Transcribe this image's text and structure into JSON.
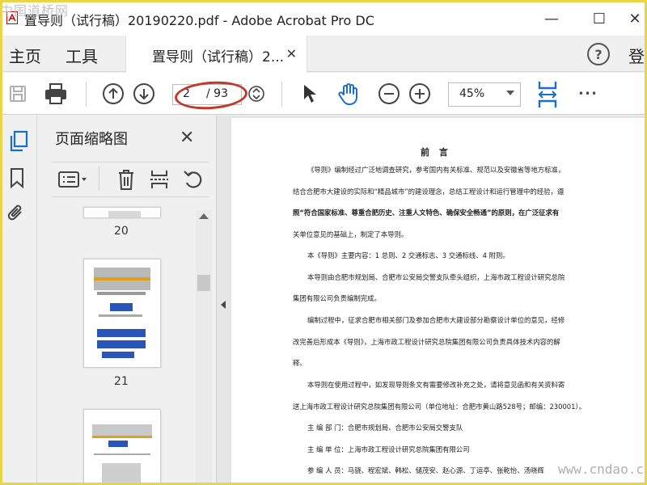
{
  "window": {
    "title": "置导则（试行稿）20190220.pdf - Adobe Acrobat Pro DC",
    "minimize": "—",
    "maximize": "☐",
    "close": "✕"
  },
  "watermark_top": "中国道桥网",
  "watermark_bottom": "www.cndao.com",
  "nav": {
    "home": "主页",
    "tools": "工具",
    "login": "登"
  },
  "doc_tab": {
    "label": "置导则（试行稿）2...",
    "close": "✕"
  },
  "help": "?",
  "toolbar": {
    "current_page": "2",
    "total_pages": "/ 93",
    "zoom": "45%",
    "more": "•••"
  },
  "panel": {
    "title": "页面缩略图",
    "close": "✕",
    "thumbnails": [
      {
        "label": "20"
      },
      {
        "label": "21"
      }
    ]
  },
  "doc": {
    "heading": "前  言",
    "lines": [
      "《导则》编制经过广泛地调查研究，参考国内有关标准、规范以及安徽省等地方标准，",
      "结合合肥市大建设的实际和“精品城市”的建设理念，总结工程设计和运行管理中的经验，遵",
      "照“符合国家标准、尊重合肥历史、注重人文特色、确保安全畅通”的原则，在广泛征求有",
      "关单位意见的基础上，制定了本导则。",
      "本《导则》主要内容：1 总则、2 交通标志、3 交通标线、4  附则。",
      "本导则由合肥市规划局、合肥市公安局交警支队牵头组织，上海市政工程设计研究总院",
      "集团有限公司负责编制完成。",
      "编制过程中，征求合肥市相关部门及参加合肥市大建设部分勘察设计单位的意见，经修",
      "改完善后形成本《导则》，上海市政工程设计研究总院集团有限公司负责具体技术内容的解",
      "释。",
      "本导则在使用过程中，如发现导则条文有需要修改补充之处，请将意见函和有关资料寄",
      "送上海市政工程设计研究总院集团有限公司（单位地址：合肥市黄山路528号；邮编：230001）。",
      "主  编  部  门：合肥市规划局、合肥市公安局交警支队",
      "主  编  单  位：上海市政工程设计研究总院集团有限公司",
      "参  编  人  员：马骁、程宏斌、韩松、储茂安、赵心源、丁运亭、张乾怡、汤晓辉"
    ]
  },
  "colors": {
    "annotation": "#c0392b",
    "accent": "#1a6fc4",
    "frame": "#e9d54a"
  }
}
